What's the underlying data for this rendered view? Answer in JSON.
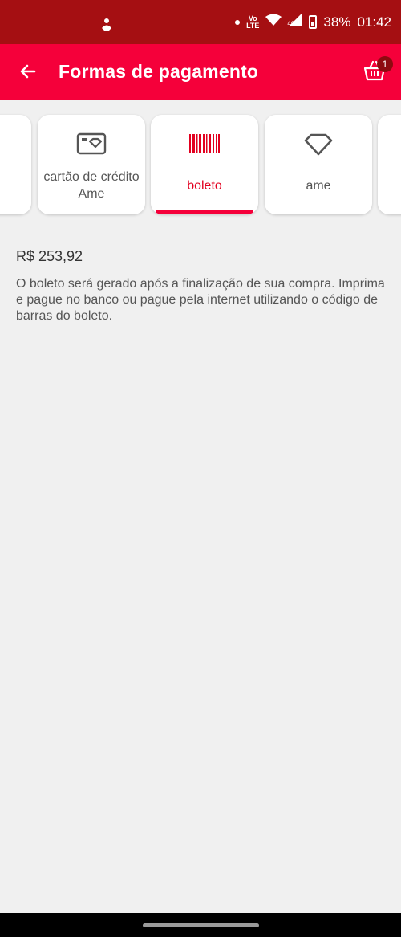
{
  "status_bar": {
    "battery": "38%",
    "time": "01:42",
    "network": "4G",
    "volte_top": "Vo",
    "volte_bottom": "LTE"
  },
  "app_bar": {
    "title": "Formas de pagamento",
    "cart_count": "1",
    "background_color": "#f5003a"
  },
  "payment_methods": [
    {
      "label": "",
      "icon": "partial-card",
      "selected": false
    },
    {
      "label": "cartão de crédito Ame",
      "icon": "credit-card-ame-icon",
      "selected": false
    },
    {
      "label": "boleto",
      "icon": "barcode-icon",
      "selected": true
    },
    {
      "label": "ame",
      "icon": "ame-diamond-icon",
      "selected": false
    },
    {
      "label": "",
      "icon": "partial-card",
      "selected": false
    }
  ],
  "content": {
    "amount": "R$ 253,92",
    "description": "O boleto será gerado após a finalização de sua compra. Imprima e pague no banco ou pague pela internet utilizando o código de barras do boleto."
  },
  "colors": {
    "status_bar": "#a50f12",
    "accent": "#e2001f",
    "background": "#f0f0f0"
  }
}
